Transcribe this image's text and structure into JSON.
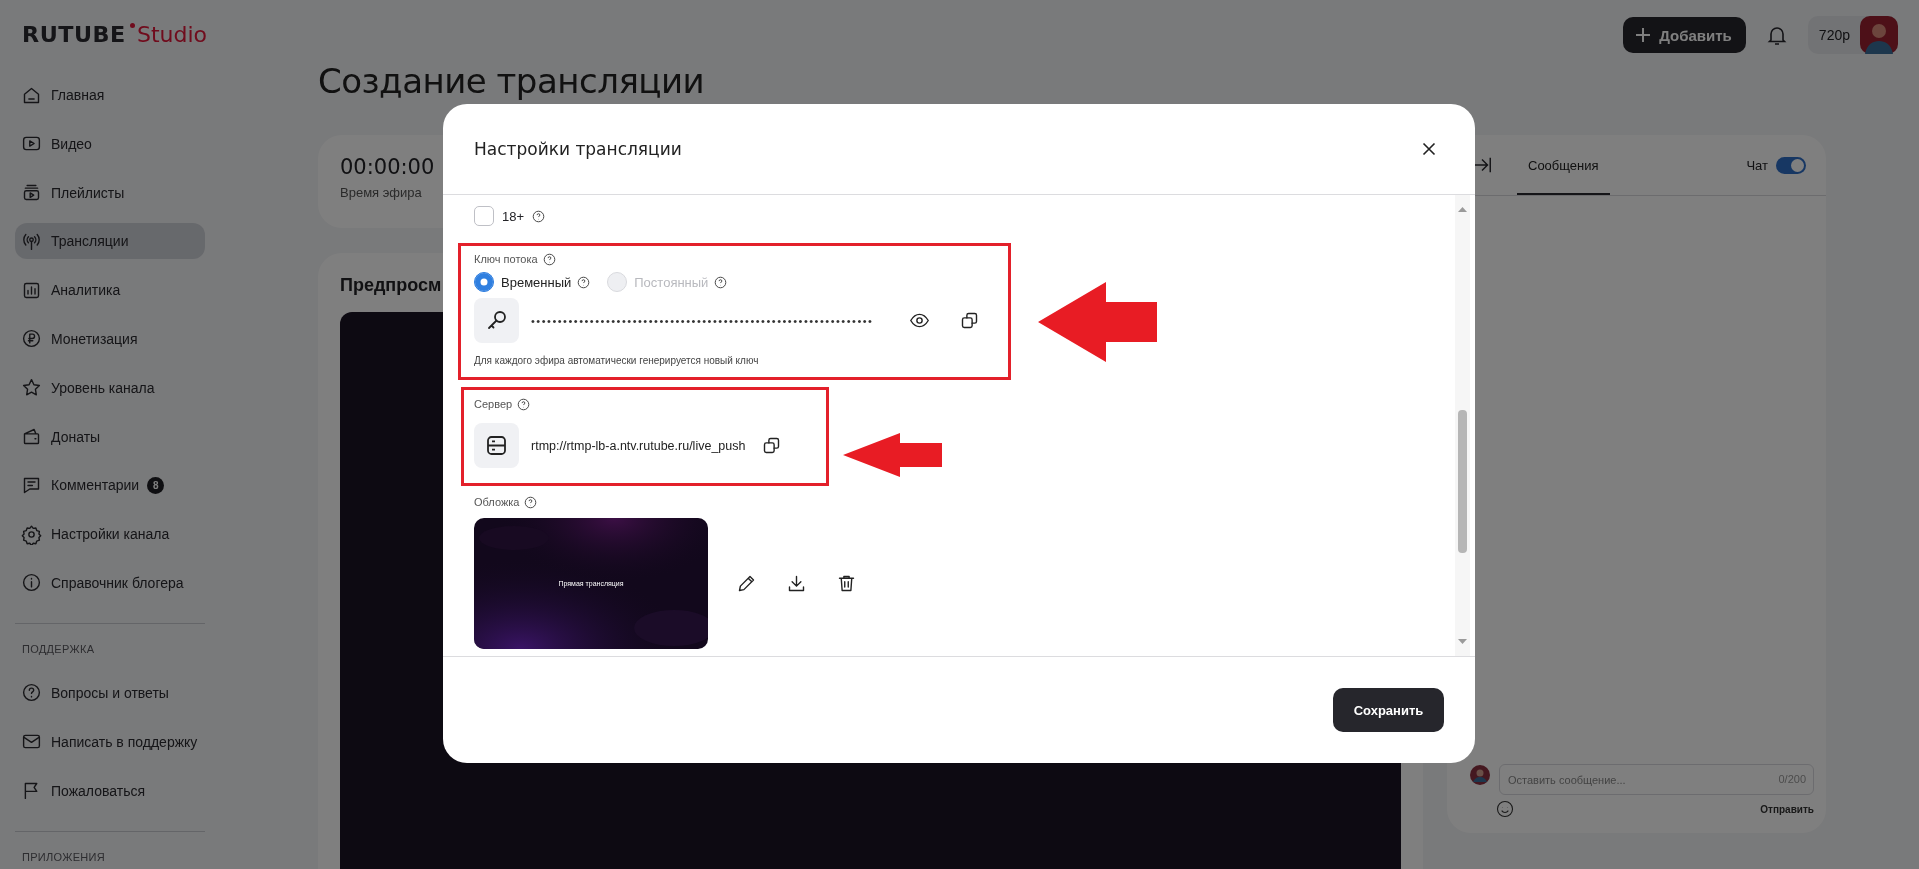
{
  "logo": {
    "brand": "RUTUBE",
    "product": "Studio"
  },
  "header": {
    "add_button": "Добавить",
    "quality": "720р"
  },
  "sidebar": {
    "items": [
      {
        "label": "Главная",
        "selected": false
      },
      {
        "label": "Видео",
        "selected": false
      },
      {
        "label": "Плейлисты",
        "selected": false
      },
      {
        "label": "Трансляции",
        "selected": true
      },
      {
        "label": "Аналитика",
        "selected": false
      },
      {
        "label": "Монетизация",
        "selected": false
      },
      {
        "label": "Уровень канала",
        "selected": false
      },
      {
        "label": "Донаты",
        "selected": false
      },
      {
        "label": "Комментарии",
        "selected": false,
        "badge": "8"
      },
      {
        "label": "Настройки канала",
        "selected": false
      },
      {
        "label": "Справочник блогера",
        "selected": false
      }
    ],
    "support": {
      "heading": "ПОДДЕРЖКА",
      "items": [
        {
          "label": "Вопросы и ответы",
          "selected": false
        },
        {
          "label": "Написать в поддержку",
          "selected": false
        },
        {
          "label": "Пожаловаться",
          "selected": false
        }
      ]
    },
    "apps": {
      "heading": "ПРИЛОЖЕНИЯ"
    }
  },
  "page": {
    "title": "Создание трансляции",
    "timer": {
      "value": "00:00:00",
      "label": "Время эфира"
    },
    "preview_title": "Предпросм"
  },
  "chat": {
    "tab": {
      "label": "Сообщения",
      "selected": true
    },
    "toggle": {
      "label": "Чат",
      "on": true
    },
    "input": {
      "placeholder": "Оставить сообщение...",
      "counter": "0/200"
    },
    "send": "Отправить"
  },
  "modal": {
    "title": "Настройки трансляции",
    "age": {
      "label": "18+",
      "checked": false
    },
    "stream_key": {
      "label": "Ключ потока",
      "options": [
        {
          "label": "Временный",
          "selected": true,
          "disabled": false
        },
        {
          "label": "Постоянный",
          "selected": false,
          "disabled": true
        }
      ],
      "value": "••••••••••••••••••••••••••••••••••••••••••••••••••••••••••••••••",
      "hint": "Для каждого эфира автоматически генерируется новый ключ"
    },
    "server": {
      "label": "Сервер",
      "value": "rtmp://rtmp-lb-a.ntv.rutube.ru/live_push"
    },
    "cover": {
      "label": "Обложка",
      "caption": "Прямая трансляция"
    },
    "save": "Сохранить"
  }
}
